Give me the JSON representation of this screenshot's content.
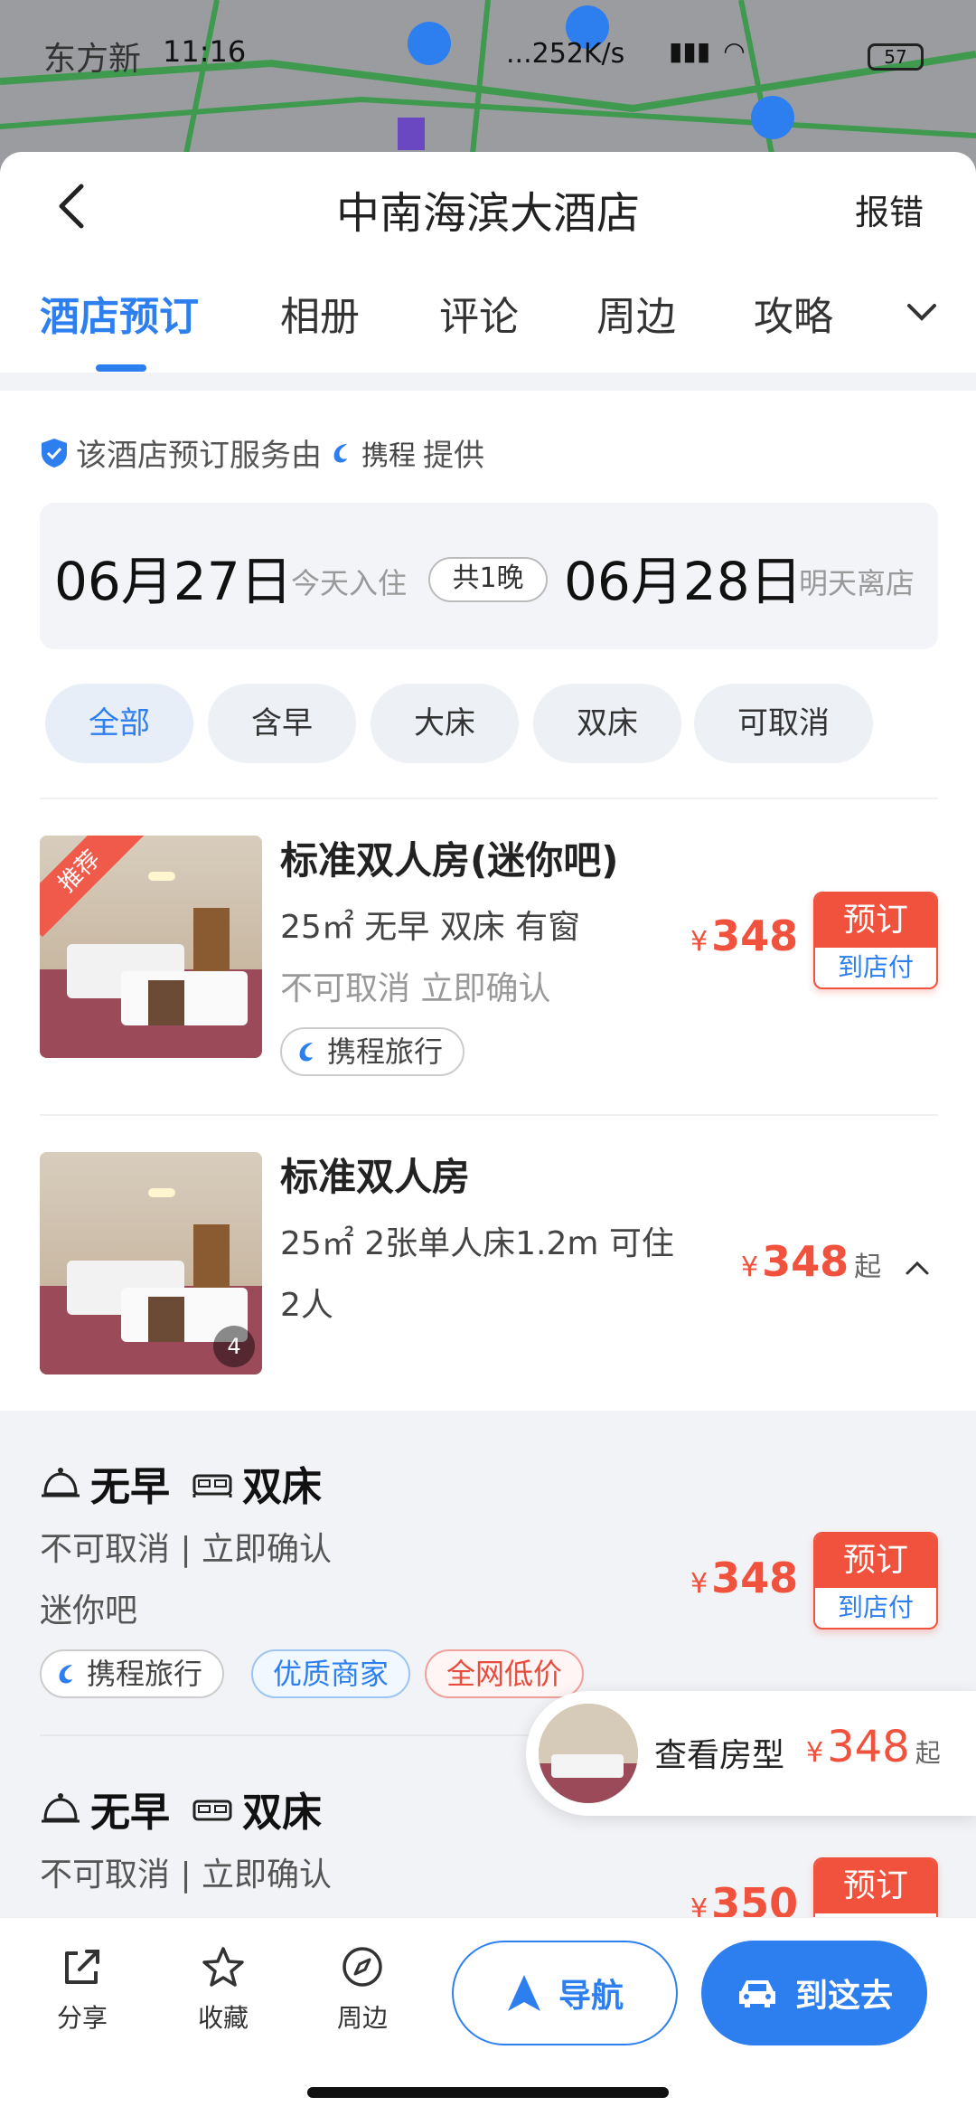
{
  "status_bar": {
    "carrier": "东方新",
    "time": "11:16",
    "net_speed": "...252K/s",
    "battery": "57"
  },
  "header": {
    "title": "中南海滨大酒店",
    "report_label": "报错"
  },
  "tabs": [
    {
      "label": "酒店预订",
      "active": true
    },
    {
      "label": "相册"
    },
    {
      "label": "评论"
    },
    {
      "label": "周边"
    },
    {
      "label": "攻略"
    }
  ],
  "provider": {
    "prefix": "该酒店预订服务由",
    "brand": "携程",
    "suffix": "提供"
  },
  "dates": {
    "checkin": "06月27日",
    "checkin_sub": "今天入住",
    "nights": "共1晚",
    "checkout": "06月28日",
    "checkout_sub": "明天离店"
  },
  "filters": [
    "全部",
    "含早",
    "大床",
    "双床",
    "可取消"
  ],
  "rooms": [
    {
      "ribbon": "推荐",
      "name": "标准双人房(迷你吧)",
      "line1": "25㎡  无早  双床  有窗",
      "line2": "不可取消  立即确认",
      "tag": "携程旅行",
      "price": "348",
      "book_top": "预订",
      "book_bottom": "到店付"
    },
    {
      "name": "标准双人房",
      "line1": "25㎡  2张单人床1.2m  可住",
      "line1b": "2人",
      "price": "348",
      "price_suffix": "起",
      "img_count": "4"
    }
  ],
  "sub_offers": [
    {
      "breakfast": "无早",
      "bed": "双床",
      "line1": "不可取消 | 立即确认",
      "line2": "迷你吧",
      "tags": [
        "携程旅行",
        "优质商家",
        "全网低价"
      ],
      "price": "348",
      "book_top": "预订",
      "book_bottom": "到店付"
    },
    {
      "breakfast": "无早",
      "bed": "双床",
      "line1": "不可取消 | 立即确认",
      "price": "350",
      "book_top": "预订"
    }
  ],
  "floating": {
    "label": "查看房型",
    "price": "348",
    "suffix": "起"
  },
  "bottom_bar": {
    "share": "分享",
    "favorite": "收藏",
    "nearby": "周边",
    "navigate": "导航",
    "go": "到这去"
  },
  "yen": "¥",
  "colors": {
    "accent": "#2d7ff0",
    "price": "#f0523e"
  }
}
